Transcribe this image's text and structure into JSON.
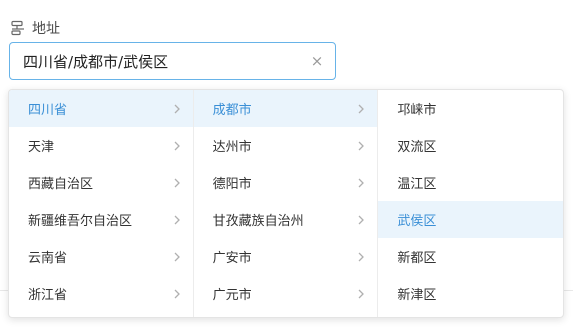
{
  "field": {
    "label": "地址",
    "label_icon": "address-node-icon",
    "value": "四川省/成都市/武侯区",
    "clear_icon": "close-icon",
    "clear_glyph": "×"
  },
  "colors": {
    "accent": "#3a8fd6",
    "active_bg": "#eaf4fc",
    "input_border": "#67b3e8"
  },
  "provinces": [
    {
      "label": "四川省",
      "active": true
    },
    {
      "label": "天津",
      "active": false
    },
    {
      "label": "西藏自治区",
      "active": false
    },
    {
      "label": "新疆维吾尔自治区",
      "active": false
    },
    {
      "label": "云南省",
      "active": false
    },
    {
      "label": "浙江省",
      "active": false
    }
  ],
  "cities": [
    {
      "label": "成都市",
      "active": true
    },
    {
      "label": "达州市",
      "active": false
    },
    {
      "label": "德阳市",
      "active": false
    },
    {
      "label": "甘孜藏族自治州",
      "active": false
    },
    {
      "label": "广安市",
      "active": false
    },
    {
      "label": "广元市",
      "active": false
    }
  ],
  "districts": [
    {
      "label": "邛崃市",
      "selected": false
    },
    {
      "label": "双流区",
      "selected": false
    },
    {
      "label": "温江区",
      "selected": false
    },
    {
      "label": "武侯区",
      "selected": true
    },
    {
      "label": "新都区",
      "selected": false
    },
    {
      "label": "新津区",
      "selected": false
    }
  ]
}
